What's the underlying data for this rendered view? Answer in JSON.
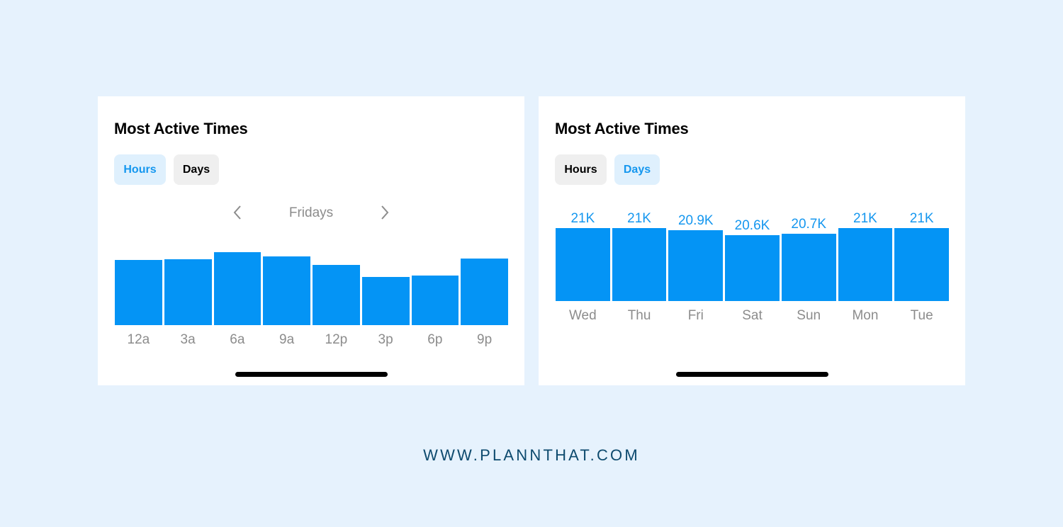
{
  "footer": {
    "url": "WWW.PLANNTHAT.COM"
  },
  "colors": {
    "background": "#e6f2fd",
    "bar": "#0494f5",
    "active_tab_bg": "#dff0fd",
    "active_tab_text": "#1597ef",
    "inactive_tab_bg": "#efefef",
    "axis_label": "#8c8c8c",
    "footer_text": "#0d4a6e"
  },
  "cards": [
    {
      "title": "Most Active Times",
      "tabs": [
        {
          "label": "Hours",
          "active": true
        },
        {
          "label": "Days",
          "active": false
        }
      ],
      "day_selector": {
        "label": "Fridays",
        "prev_icon": "chevron-left-icon",
        "next_icon": "chevron-right-icon"
      }
    },
    {
      "title": "Most Active Times",
      "tabs": [
        {
          "label": "Hours",
          "active": false
        },
        {
          "label": "Days",
          "active": true
        }
      ]
    }
  ],
  "chart_data": [
    {
      "type": "bar",
      "title": "Most Active Times — Hours (Fridays)",
      "categories": [
        "12a",
        "3a",
        "6a",
        "9a",
        "12p",
        "3p",
        "6p",
        "9p"
      ],
      "values": [
        0.89,
        0.9,
        1.0,
        0.94,
        0.83,
        0.66,
        0.68,
        0.91
      ],
      "value_note": "relative activity (fraction of peak); no axis or data labels shown",
      "xlabel": "",
      "ylabel": "",
      "ylim": [
        0,
        1
      ],
      "grid": false,
      "legend": "none"
    },
    {
      "type": "bar",
      "title": "Most Active Times — Days",
      "categories": [
        "Wed",
        "Thu",
        "Fri",
        "Sat",
        "Sun",
        "Mon",
        "Tue"
      ],
      "values": [
        21000,
        21000,
        20900,
        20600,
        20700,
        21000,
        21000
      ],
      "data_labels": [
        "21K",
        "21K",
        "20.9K",
        "20.6K",
        "20.7K",
        "21K",
        "21K"
      ],
      "xlabel": "",
      "ylabel": "",
      "ylim": [
        0,
        21000
      ],
      "grid": false,
      "legend": "none"
    }
  ]
}
